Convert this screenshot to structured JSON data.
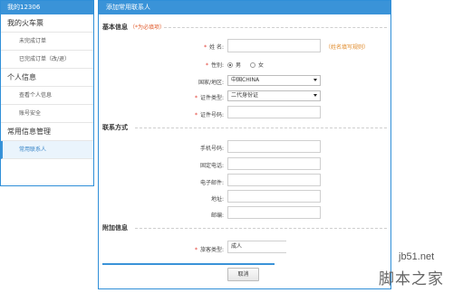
{
  "sidebar": {
    "header": "我的12306",
    "groups": [
      {
        "label": "我的火车票",
        "items": [
          "未完成订单",
          "已完成订单（改/退）"
        ]
      },
      {
        "label": "个人信息",
        "items": [
          "查看个人信息",
          "账号安全"
        ]
      },
      {
        "label": "常用信息管理",
        "items": [
          "常用联系人"
        ]
      }
    ]
  },
  "panel": {
    "title": "添加常用联系人",
    "basic": {
      "title": "基本信息",
      "required_note": "（*为必填项）",
      "name_label": "姓 名:",
      "name_hint": "（姓名填写规则）",
      "gender_label": "性别:",
      "gender_male": "男",
      "gender_female": "女",
      "country_label": "国家/地区:",
      "country_value": "中国CHINA",
      "idtype_label": "证件类型:",
      "idtype_value": "二代身份证",
      "idnum_label": "证件号码:"
    },
    "contact": {
      "title": "联系方式",
      "mobile_label": "手机号码:",
      "phone_label": "固定电话:",
      "email_label": "电子邮件:",
      "address_label": "地址:",
      "postcode_label": "邮编:"
    },
    "extra": {
      "title": "附加信息",
      "passenger_type_label": "旅客类型:",
      "passenger_type_value": "成人"
    },
    "cancel_label": "取消"
  },
  "watermark": {
    "line1": "jb51.net",
    "line2": "脚本之家"
  },
  "colors": {
    "accent": "#3a93d8",
    "required": "#e0352a",
    "hint": "#e08a2a"
  }
}
